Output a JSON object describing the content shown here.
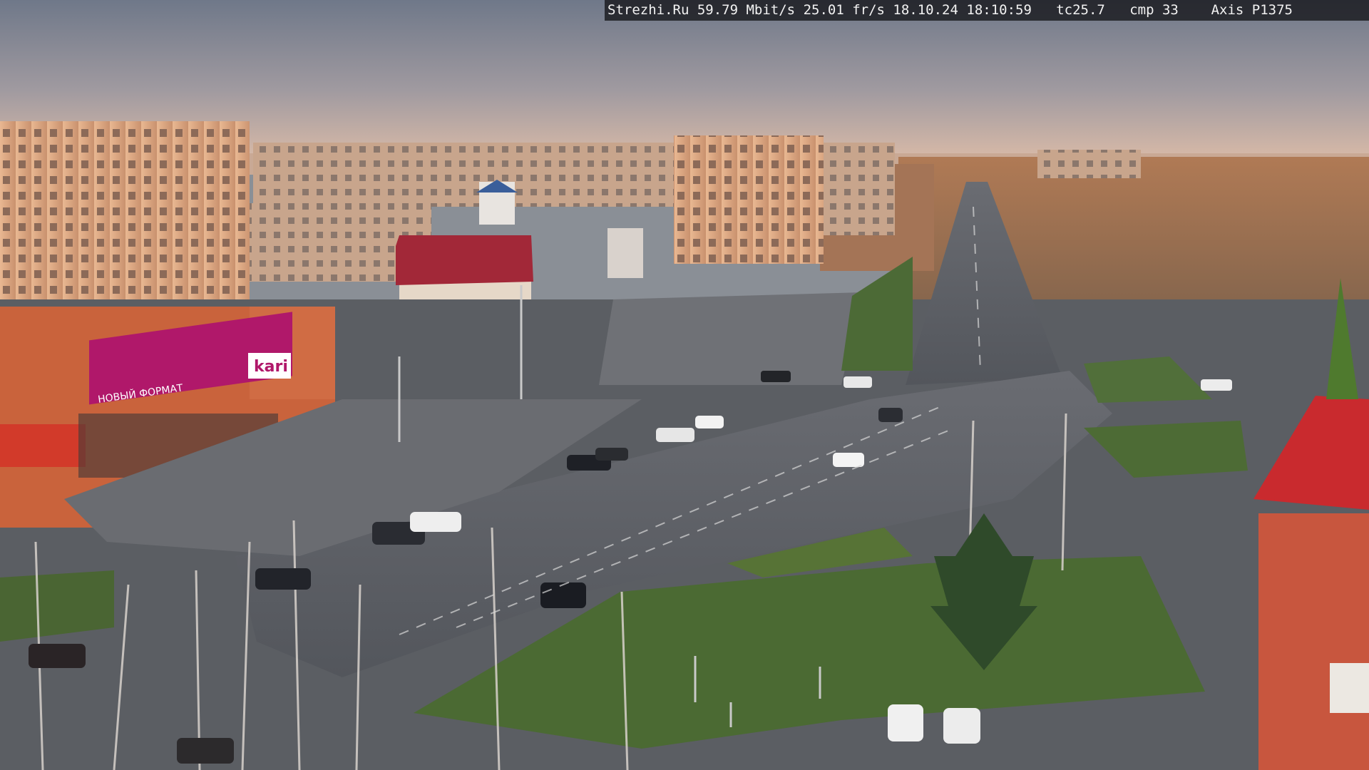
{
  "overlay": {
    "site": "Strezhi.Ru",
    "bitrate": "59.79 Mbit/s",
    "framerate": "25.01 fr/s",
    "date": "18.10.24",
    "time": "18:10:59",
    "tc": "tc25.7",
    "cmp": "cmp 33",
    "camera": "Axis P1375"
  },
  "signs": {
    "kari_logo": "kari",
    "kari_logo_small": "kari",
    "kari_left_text": "НОВЫЙ ФОРМАТ"
  },
  "colors": {
    "sky_top": "#7d8595",
    "sky_horizon": "#d9b9a8",
    "asphalt": "#5d6066",
    "grass": "#4d6a38",
    "kari_magenta": "#b0186a",
    "building_warm": "#e2b08c"
  }
}
